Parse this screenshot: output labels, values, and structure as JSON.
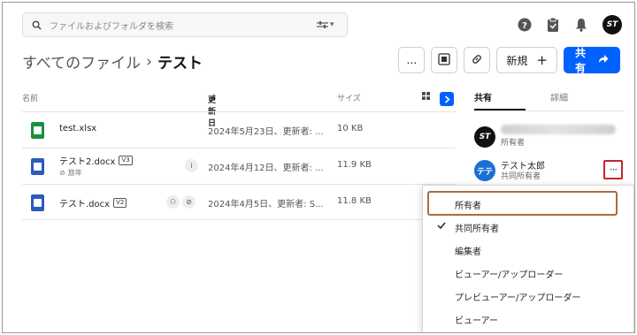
{
  "search": {
    "placeholder": "ファイルおよびフォルダを検索"
  },
  "breadcrumb": {
    "parent": "すべてのファイル",
    "separator": "›",
    "current": "テスト"
  },
  "actions": {
    "more": "…",
    "new_label": "新規",
    "share_label": "共有"
  },
  "table": {
    "headers": {
      "name": "名前",
      "modified": "更新日",
      "size": "サイズ"
    },
    "rows": [
      {
        "name": "test.xlsx",
        "type": "xlsx",
        "version": "",
        "tag": "",
        "date": "2024年5月23日、更新者: ...",
        "size": "10 KB"
      },
      {
        "name": "テスト2.docx",
        "type": "docx",
        "version": "V3",
        "tag": "旅年",
        "date": "2024年4月12日、更新者: ...",
        "size": "11.9 KB"
      },
      {
        "name": "テスト.docx",
        "type": "docx",
        "version": "V2",
        "tag": "",
        "date": "2024年4月5日、更新者: S...",
        "size": "11.8 KB"
      }
    ]
  },
  "panel": {
    "tabs": [
      "共有",
      "詳細"
    ],
    "members": [
      {
        "name": "",
        "role": "所有者",
        "avatar": "ST"
      },
      {
        "name": "テスト太郎",
        "role": "共同所有者",
        "avatar": "テテ"
      }
    ]
  },
  "menu": {
    "options": [
      "所有者",
      "共同所有者",
      "編集者",
      "ビューアー/アップローダー",
      "プレビューアー/アップローダー",
      "ビューアー"
    ],
    "checked": "共同所有者"
  },
  "colors": {
    "accent": "#0061fe",
    "highlight_border": "#c0262d",
    "selected_border": "#a76d3f"
  }
}
